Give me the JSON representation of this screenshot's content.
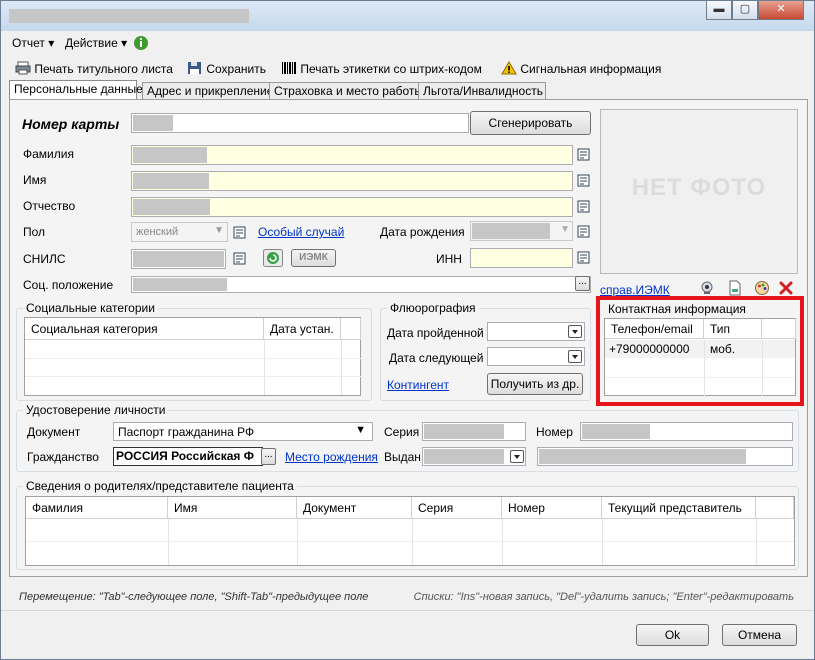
{
  "menu": {
    "report": "Отчет ▾",
    "action": "Действие ▾"
  },
  "toolbar": {
    "print_title": "Печать титульного листа",
    "save": "Сохранить",
    "print_labels": "Печать этикетки со штрих-кодом",
    "signal": "Сигнальная информация"
  },
  "tabs": [
    "Персональные данные",
    "Адрес и прикрепление",
    "Страховка и место работы",
    "Льгота/Инвалидность"
  ],
  "form": {
    "card_no_label": "Номер карты",
    "generate_btn": "Сгенерировать",
    "surname_label": "Фамилия",
    "name_label": "Имя",
    "patronymic_label": "Отчество",
    "sex_label": "Пол",
    "sex_value": "женский",
    "special_case_link": "Особый случай",
    "dob_label": "Дата рождения",
    "snils_label": "СНИЛС",
    "iemk_btn": "ИЭМК",
    "inn_label": "ИНН",
    "social_status_label": "Соц. положение",
    "no_photo": "НЕТ ФОТО",
    "iemk_ref_link": "справ.ИЭМК"
  },
  "social": {
    "title": "Социальные категории",
    "columns": [
      "Социальная категория",
      "Дата устан."
    ]
  },
  "fluoro": {
    "title": "Флюорография",
    "done_label": "Дата пройденной",
    "next_label": "Дата следующей",
    "contingent_link": "Контингент",
    "fetch_btn": "Получить из др."
  },
  "contact": {
    "title": "Контактная информация",
    "columns": [
      "Телефон/email",
      "Тип"
    ],
    "rows": [
      {
        "value": "+79000000000",
        "type": "моб."
      }
    ]
  },
  "identity": {
    "title": "Удостоверение личности",
    "doc_label": "Документ",
    "doc_value": "Паспорт гражданина РФ",
    "series_label": "Серия",
    "number_label": "Номер",
    "citizenship_label": "Гражданство",
    "citizenship_value": "РОССИЯ Российская Ф",
    "birthplace_link": "Место рождения",
    "issued_label": "Выдан"
  },
  "parents": {
    "title": "Сведения о родителях/представителе пациента",
    "columns": [
      "Фамилия",
      "Имя",
      "Документ",
      "Серия",
      "Номер",
      "Текущий представитель"
    ]
  },
  "hints": {
    "left": "Перемещение: \"Tab\"-следующее поле, \"Shift-Tab\"-предыдущее поле",
    "right": "Списки: \"Ins\"-новая запись, \"Del\"-удалить запись; \"Enter\"-редактировать"
  },
  "buttons": {
    "ok": "Ok",
    "cancel": "Отмена"
  },
  "colors": {
    "highlight": "#e8141c",
    "link": "#0033cc",
    "required_field": "#ffffe1"
  }
}
